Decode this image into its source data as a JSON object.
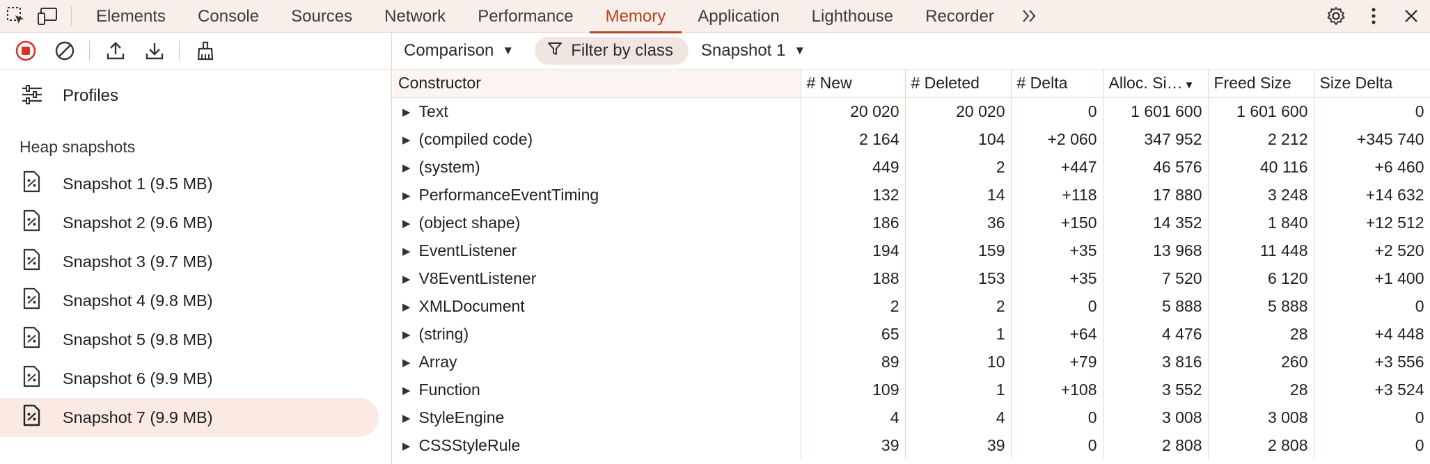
{
  "toolbar": {
    "tabs": [
      {
        "label": "Elements"
      },
      {
        "label": "Console"
      },
      {
        "label": "Sources"
      },
      {
        "label": "Network"
      },
      {
        "label": "Performance"
      },
      {
        "label": "Memory"
      },
      {
        "label": "Application"
      },
      {
        "label": "Lighthouse"
      },
      {
        "label": "Recorder"
      }
    ],
    "more_tabs_label": "»",
    "active_tab": "Memory",
    "accent_color": "#b3441c"
  },
  "sidebar": {
    "profiles_label": "Profiles",
    "section_title": "Heap snapshots",
    "snapshots": [
      {
        "label": "Snapshot 1 (9.5 MB)"
      },
      {
        "label": "Snapshot 2 (9.6 MB)"
      },
      {
        "label": "Snapshot 3 (9.7 MB)"
      },
      {
        "label": "Snapshot 4 (9.8 MB)"
      },
      {
        "label": "Snapshot 5 (9.8 MB)"
      },
      {
        "label": "Snapshot 6 (9.9 MB)"
      },
      {
        "label": "Snapshot 7 (9.9 MB)"
      }
    ],
    "selected_snapshot": "Snapshot 7 (9.9 MB)"
  },
  "main": {
    "view_mode": "Comparison",
    "filter_label": "Filter by class",
    "base_snapshot": "Snapshot 1",
    "columns": [
      "Constructor",
      "# New",
      "# Deleted",
      "# Delta",
      "Alloc. Si…",
      "Freed Size",
      "Size Delta"
    ],
    "sorted_column_caret": "▼",
    "rows": [
      {
        "name": "Text",
        "new": "20 020",
        "deleted": "20 020",
        "delta": "0",
        "alloc": "1 601 600",
        "freed": "1 601 600",
        "size_delta": "0"
      },
      {
        "name": "(compiled code)",
        "new": "2 164",
        "deleted": "104",
        "delta": "+2 060",
        "alloc": "347 952",
        "freed": "2 212",
        "size_delta": "+345 740"
      },
      {
        "name": "(system)",
        "new": "449",
        "deleted": "2",
        "delta": "+447",
        "alloc": "46 576",
        "freed": "40 116",
        "size_delta": "+6 460"
      },
      {
        "name": "PerformanceEventTiming",
        "new": "132",
        "deleted": "14",
        "delta": "+118",
        "alloc": "17 880",
        "freed": "3 248",
        "size_delta": "+14 632"
      },
      {
        "name": "(object shape)",
        "new": "186",
        "deleted": "36",
        "delta": "+150",
        "alloc": "14 352",
        "freed": "1 840",
        "size_delta": "+12 512"
      },
      {
        "name": "EventListener",
        "new": "194",
        "deleted": "159",
        "delta": "+35",
        "alloc": "13 968",
        "freed": "11 448",
        "size_delta": "+2 520"
      },
      {
        "name": "V8EventListener",
        "new": "188",
        "deleted": "153",
        "delta": "+35",
        "alloc": "7 520",
        "freed": "6 120",
        "size_delta": "+1 400"
      },
      {
        "name": "XMLDocument",
        "new": "2",
        "deleted": "2",
        "delta": "0",
        "alloc": "5 888",
        "freed": "5 888",
        "size_delta": "0"
      },
      {
        "name": "(string)",
        "new": "65",
        "deleted": "1",
        "delta": "+64",
        "alloc": "4 476",
        "freed": "28",
        "size_delta": "+4 448"
      },
      {
        "name": "Array",
        "new": "89",
        "deleted": "10",
        "delta": "+79",
        "alloc": "3 816",
        "freed": "260",
        "size_delta": "+3 556"
      },
      {
        "name": "Function",
        "new": "109",
        "deleted": "1",
        "delta": "+108",
        "alloc": "3 552",
        "freed": "28",
        "size_delta": "+3 524"
      },
      {
        "name": "StyleEngine",
        "new": "4",
        "deleted": "4",
        "delta": "0",
        "alloc": "3 008",
        "freed": "3 008",
        "size_delta": "0"
      },
      {
        "name": "CSSStyleRule",
        "new": "39",
        "deleted": "39",
        "delta": "0",
        "alloc": "2 808",
        "freed": "2 808",
        "size_delta": "0"
      }
    ]
  }
}
